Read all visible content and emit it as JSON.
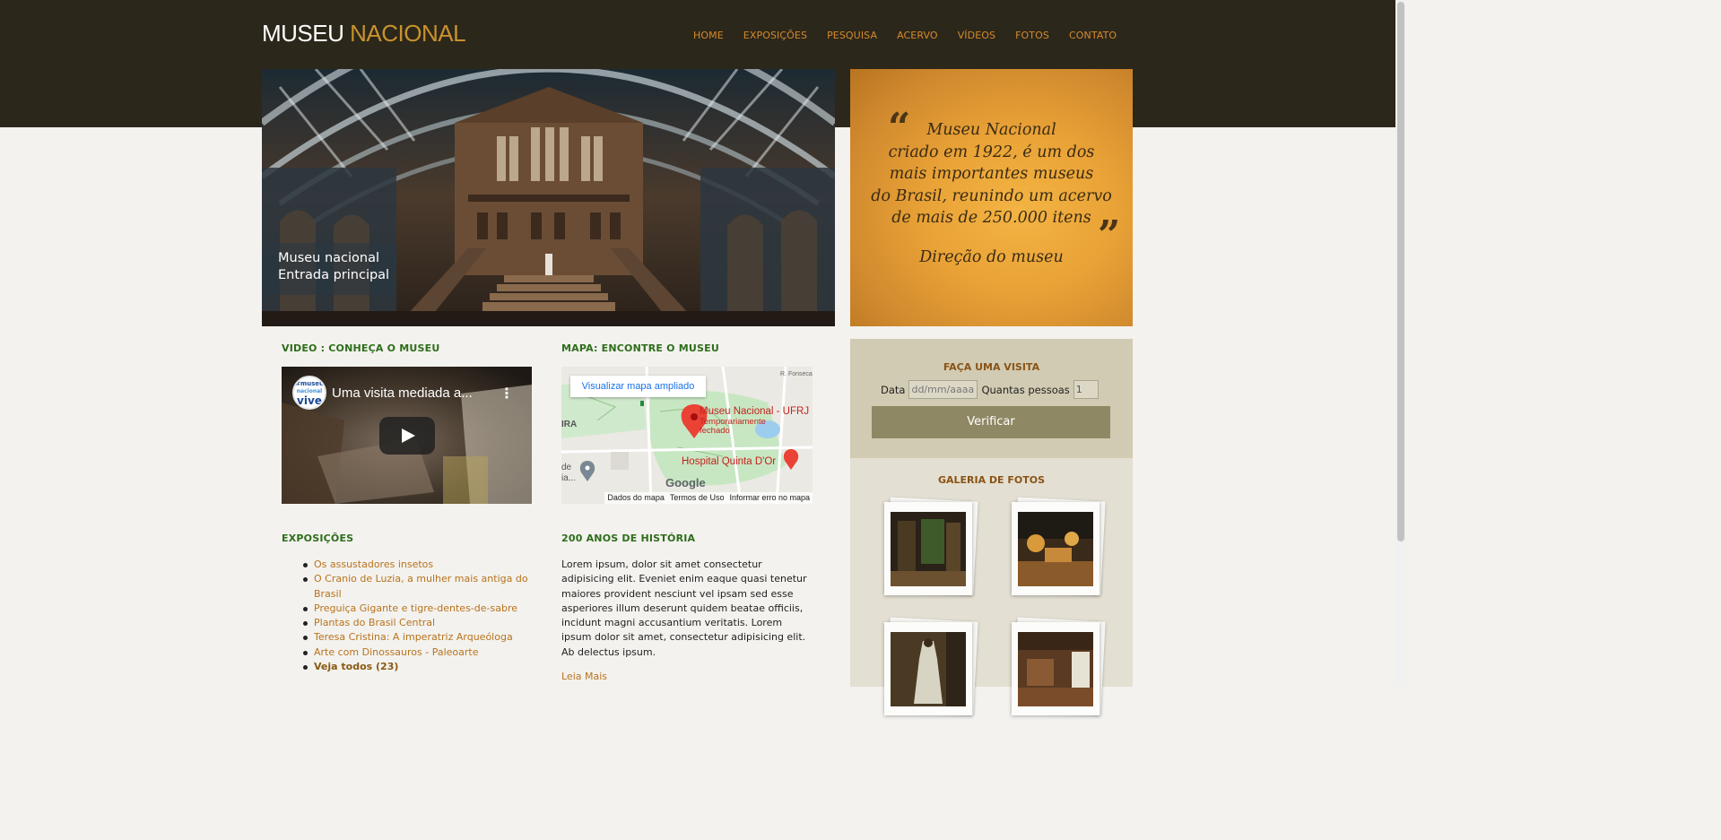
{
  "logo": {
    "part1": "MUSEU ",
    "part2": "NACIONAL"
  },
  "nav": {
    "items": [
      "HOME",
      "EXPOSIÇÕES",
      "PESQUISA",
      "ACERVO",
      "VÍDEOS",
      "FOTOS",
      "CONTATO"
    ]
  },
  "hero": {
    "caption_line1": "Museu nacional",
    "caption_line2": "Entrada principal"
  },
  "quote": {
    "lines": [
      "Museu Nacional",
      "criado em 1922, é um dos",
      "mais importantes museus",
      "do Brasil, reunindo um acervo",
      "de mais de 250.000 itens"
    ],
    "signature": "Direção do museu"
  },
  "video_section": {
    "heading": "VIDEO : CONHEÇA O MUSEU",
    "video_title": "Uma visita mediada a...",
    "channel_tag_1": "#museu",
    "channel_tag_2": "nacional",
    "channel_tag_3": "vive"
  },
  "map_section": {
    "heading": "MAPA: ENCONTRE O MUSEU",
    "enlarge_label": "Visualizar mapa ampliado",
    "place_name": "Museu Nacional - UFRJ",
    "place_status_1": "Temporariamente",
    "place_status_2": "fechado",
    "hospital": "Hospital Quinta D'Or",
    "street_label": "R. Fonseca",
    "side_label_1": "IRA",
    "side_label_2": "de",
    "side_label_3": "ia...",
    "google": "Google",
    "footer": [
      "Dados do mapa",
      "Termos de Uso",
      "Informar erro no mapa"
    ]
  },
  "exhibitions": {
    "heading": "EXPOSIÇÕES",
    "items": [
      "Os assustadores insetos",
      "O Cranio de Luzia, a mulher mais antiga do Brasil",
      "Preguiça Gigante e tigre-dentes-de-sabre",
      "Plantas do Brasil Central",
      "Teresa Cristina: A imperatriz Arqueóloga",
      "Arte com Dinossauros - Paleoarte"
    ],
    "see_all": "Veja todos (23)"
  },
  "history": {
    "heading": "200 ANOS DE HISTÓRIA",
    "text": "Lorem ipsum, dolor sit amet consectetur adipisicing elit. Eveniet enim eaque quasi tenetur maiores provident nesciunt vel ipsam sed esse asperiores illum deserunt quidem beatae officiis, incidunt magni accusantium veritatis. Lorem ipsum dolor sit amet, consectetur adipisicing elit. Ab delectus ipsum.",
    "more": "Leia Mais"
  },
  "visit": {
    "title": "FAÇA UMA VISITA",
    "date_label": "Data",
    "date_placeholder": "dd/mm/aaaa",
    "people_label": "Quantas pessoas",
    "people_value": "1",
    "button": "Verificar"
  },
  "gallery": {
    "title": "GALERIA DE FOTOS"
  },
  "colors": {
    "header_bg": "#2c271b",
    "accent": "#d58a2b",
    "heading_green": "#2e6d1b",
    "link": "#b8731d"
  }
}
